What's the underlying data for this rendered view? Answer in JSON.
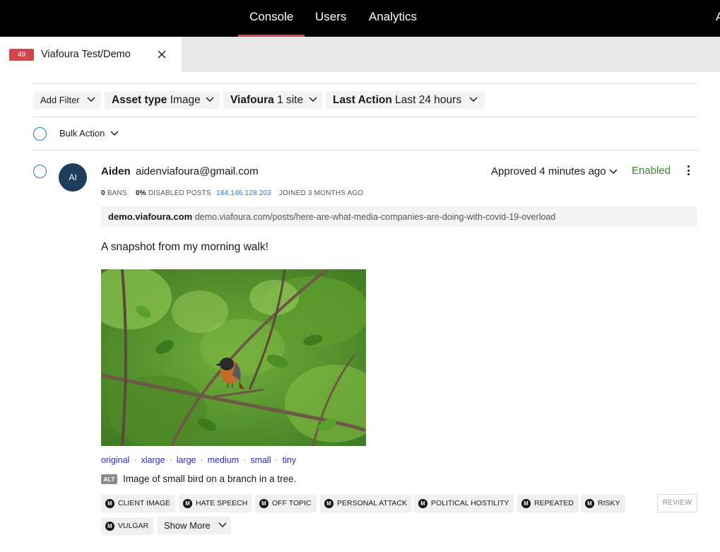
{
  "nav": {
    "items": [
      {
        "label": "Console",
        "active": true
      },
      {
        "label": "Users"
      },
      {
        "label": "Analytics"
      },
      {
        "label": "A"
      }
    ]
  },
  "tab": {
    "count": "49",
    "title": "Viafoura Test/Demo"
  },
  "filters": {
    "add_filter": "Add Filter",
    "asset_type": {
      "label": "Asset type",
      "value": "Image"
    },
    "viafoura": {
      "label": "Viafoura",
      "value": "1 site"
    },
    "last_action": {
      "label": "Last Action",
      "value": "Last 24 hours"
    }
  },
  "bulk_action": "Bulk Action",
  "comment": {
    "avatar_initials": "AI",
    "username": "Aiden",
    "email": "aidenviafoura@gmail.com",
    "status": "Approved 4 minutes ago",
    "enabled": "Enabled",
    "meta": {
      "bans_count": "0",
      "bans_label": "BANS",
      "disabled_pct": "0%",
      "disabled_label": "DISABLED POSTS",
      "ip": "184.146.128.203",
      "joined": "JOINED 3 MONTHS AGO"
    },
    "site": "demo.viafoura.com",
    "url": "demo.viafoura.com/posts/here-are-what-media-companies-are-doing-with-covid-19-overload",
    "text": "A snapshot from my morning walk!",
    "image_sizes": [
      "original",
      "xlarge",
      "large",
      "medium",
      "small",
      "tiny"
    ],
    "alt_tag": "ALT",
    "alt_text": "Image of small bird on a branch in a tree.",
    "chips": [
      "CLIENT IMAGE",
      "HATE SPEECH",
      "OFF TOPIC",
      "PERSONAL ATTACK",
      "POLITICAL HOSTILITY",
      "REPEATED",
      "RISKY",
      "VULGAR"
    ],
    "chip_badge": "M",
    "review_label": "REVIEW",
    "show_more": "Show More"
  },
  "colors": {
    "accent": "#d6454c",
    "link": "#2079d4",
    "enabled": "#3a8a2a",
    "nav_bg": "#000000"
  },
  "icons": [
    "close-icon",
    "chevron-down-icon",
    "kebab-menu-icon",
    "moderation-m-icon"
  ]
}
